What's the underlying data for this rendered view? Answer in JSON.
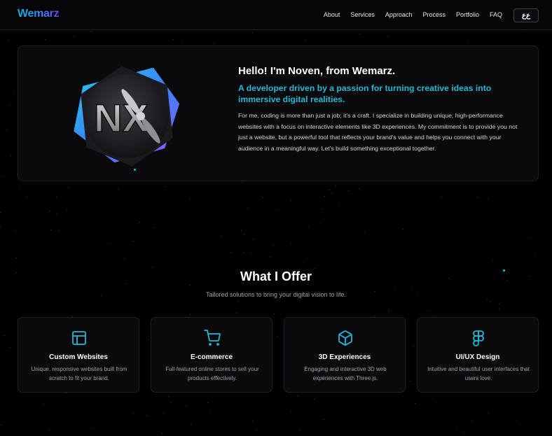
{
  "nav": {
    "logo": "Wemarz",
    "links": [
      "About",
      "Services",
      "Approach",
      "Process",
      "Portfolio",
      "FAQ"
    ],
    "lang_label": "ﻉﻉ"
  },
  "hero": {
    "logo_text": "NX",
    "title": "Hello! I'm Noven, from Wemarz.",
    "subtitle": "A developer driven by a passion for turning creative ideas into immersive digital realities.",
    "body": "For me, coding is more than just a job; it's a craft. I specialize in building unique, high-performance websites with a focus on interactive elements like 3D experiences. My commitment is to provide you not just a website, but a powerful tool that reflects your brand's value and helps you connect with your audience in a meaningful way. Let's build something exceptional together."
  },
  "offer": {
    "title": "What I Offer",
    "subtitle": "Tailored solutions to bring your digital vision to life.",
    "cards": [
      {
        "icon": "layout-icon",
        "title": "Custom Websites",
        "desc": "Unique, responsive websites built from scratch to fit your brand."
      },
      {
        "icon": "cart-icon",
        "title": "E-commerce",
        "desc": "Full-featured online stores to sell your products effectively."
      },
      {
        "icon": "cube-icon",
        "title": "3D Experiences",
        "desc": "Engaging and interactive 3D web experiences with Three.js."
      },
      {
        "icon": "figma-icon",
        "title": "UI/UX Design",
        "desc": "Intuitive and beautiful user interfaces that users love."
      }
    ]
  },
  "colors": {
    "accent": "#22b8d6",
    "logo_gradient": [
      "#06b6d4",
      "#3b82f6",
      "#7c3aed"
    ],
    "background": "#000000",
    "card_bg": "#0a0a0d"
  }
}
